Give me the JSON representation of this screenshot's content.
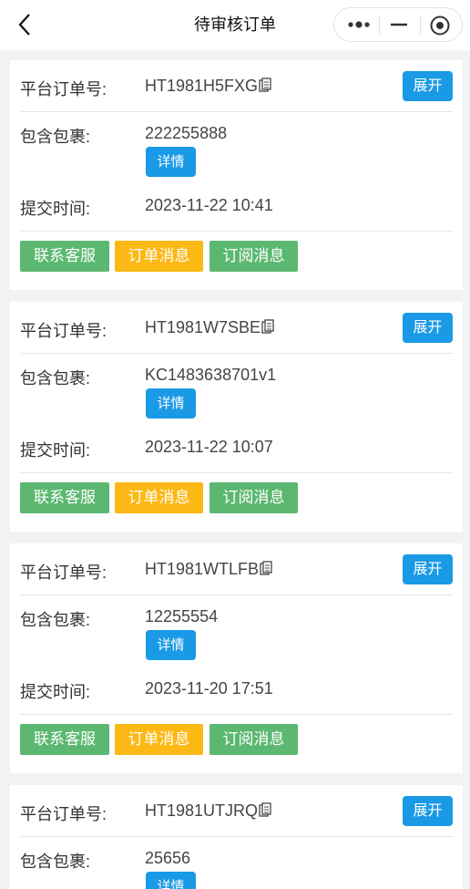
{
  "nav": {
    "title": "待审核订单",
    "back_icon": "chevron-left-icon",
    "more_icon": "more-dots-icon",
    "minimize_icon": "minimize-icon",
    "close_icon": "target-close-icon"
  },
  "labels": {
    "order_no": "平台订单号:",
    "packages": "包含包裹:",
    "submit_time": "提交时间:",
    "expand": "展开",
    "detail": "详情",
    "contact_service": "联系客服",
    "order_message": "订单消息",
    "subscribe_message": "订阅消息"
  },
  "colors": {
    "primary_blue": "#1a9ae6",
    "green": "#5cb870",
    "orange": "#fcb814"
  },
  "orders": [
    {
      "order_no": "HT1981H5FXG",
      "package": "222255888",
      "submit_time": "2023-11-22 10:41"
    },
    {
      "order_no": "HT1981W7SBE",
      "package": "KC1483638701v1",
      "submit_time": "2023-11-22 10:07"
    },
    {
      "order_no": "HT1981WTLFB",
      "package": "12255554",
      "submit_time": "2023-11-20 17:51"
    },
    {
      "order_no": "HT1981UTJRQ",
      "package": "25656",
      "submit_time": ""
    }
  ]
}
